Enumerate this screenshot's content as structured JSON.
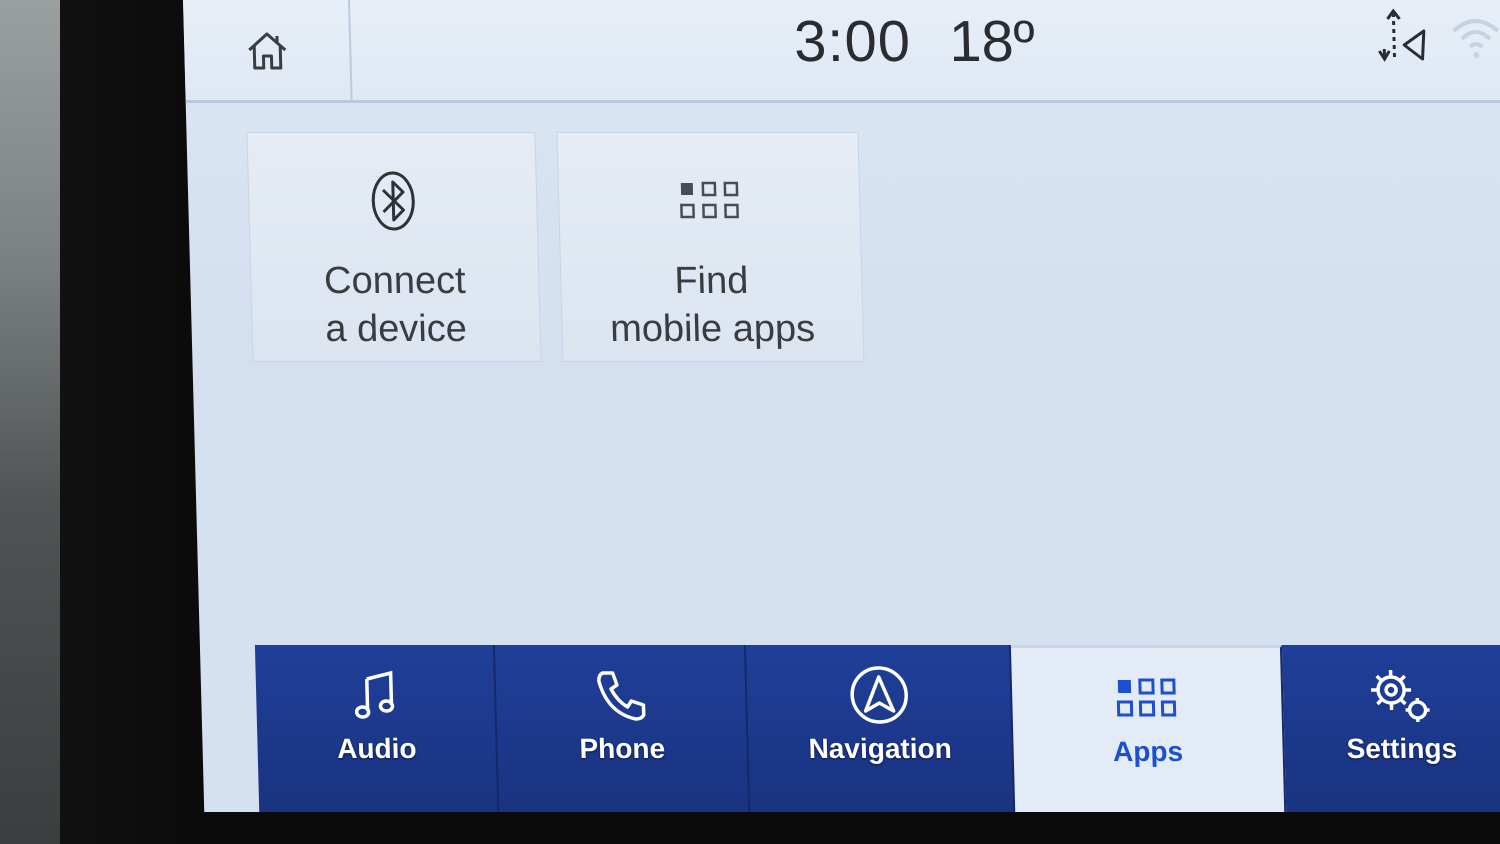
{
  "status_bar": {
    "time": "3:00",
    "temperature": "18º",
    "icons": [
      "home-icon",
      "phone-transfer-icon",
      "wifi-icon"
    ]
  },
  "tiles": [
    {
      "label_line1": "Connect",
      "label_line2": "a device",
      "icon": "bluetooth-icon"
    },
    {
      "label_line1": "Find",
      "label_line2": "mobile apps",
      "icon": "apps-grid-icon"
    }
  ],
  "nav": {
    "items": [
      {
        "label": "Audio",
        "icon": "music-note-icon"
      },
      {
        "label": "Phone",
        "icon": "phone-icon"
      },
      {
        "label": "Navigation",
        "icon": "navigation-icon"
      },
      {
        "label": "Apps",
        "icon": "apps-grid-icon",
        "active": true
      },
      {
        "label": "Settings",
        "icon": "gear-icon"
      }
    ]
  },
  "colors": {
    "nav_background": "#1f3f99",
    "active_tab_background": "#e3ebf6",
    "active_label": "#1d4fd1",
    "screen_background": "#d6e1ef"
  }
}
